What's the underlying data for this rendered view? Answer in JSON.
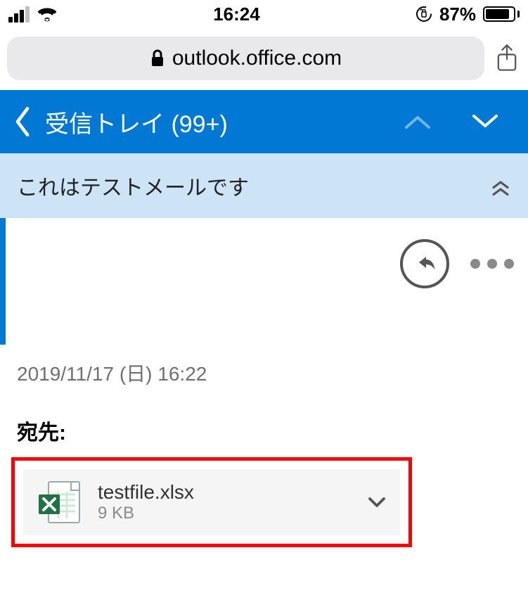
{
  "status": {
    "time": "16:24",
    "battery_pct": "87%",
    "battery_fill_pct": 87
  },
  "browser": {
    "url": "outlook.office.com"
  },
  "header": {
    "back_label": "受信トレイ (99+)"
  },
  "subject": {
    "text": "これはテストメールです"
  },
  "message": {
    "date": "2019/11/17 (日) 16:22",
    "to_label": "宛先:"
  },
  "attachment": {
    "filename": "testfile.xlsx",
    "size": "9 KB"
  }
}
